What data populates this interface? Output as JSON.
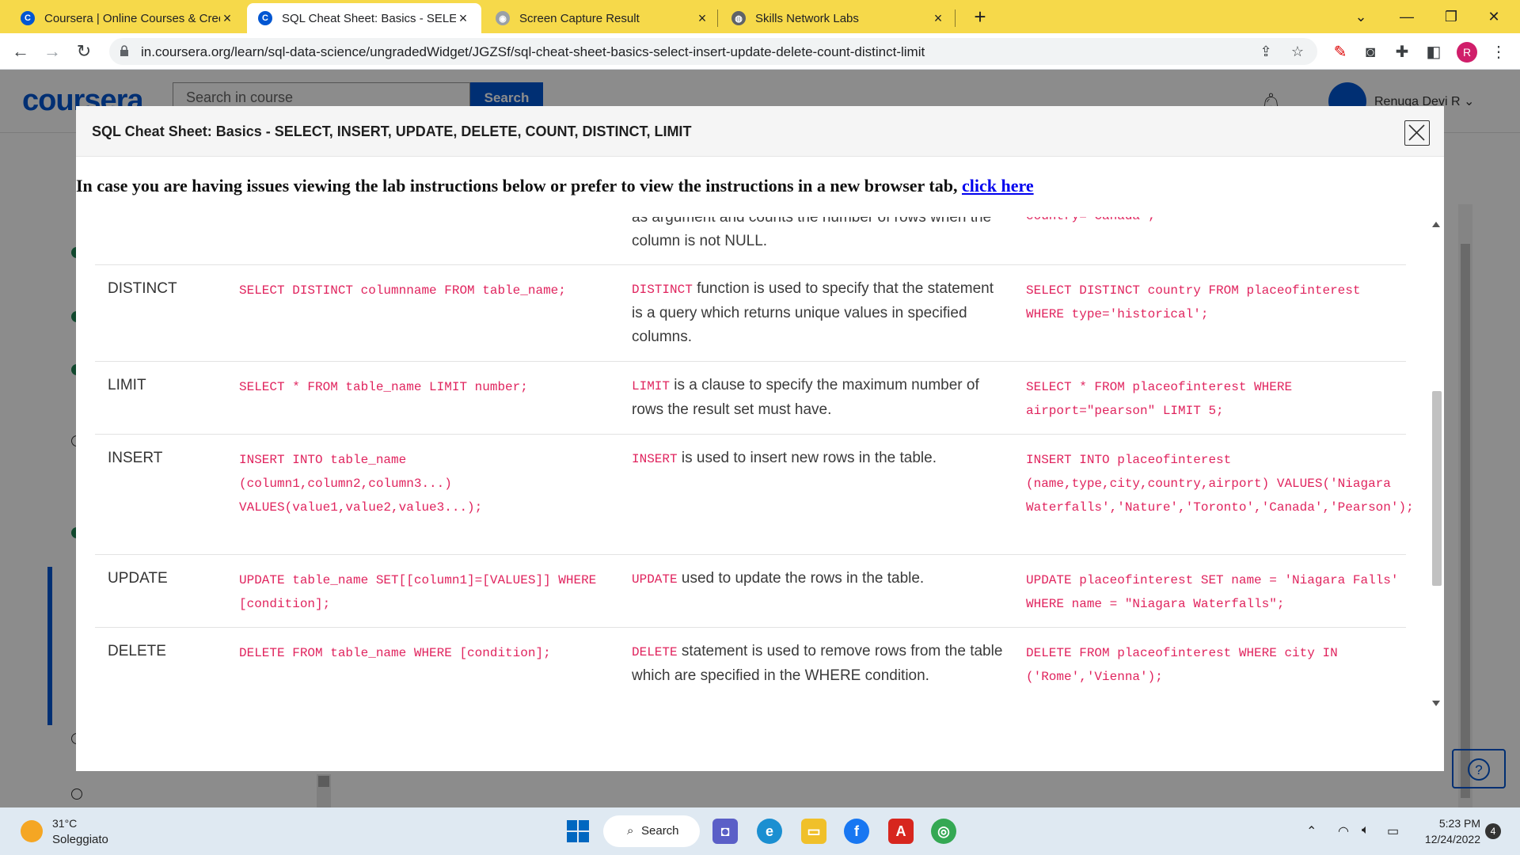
{
  "browser": {
    "tabs": [
      {
        "title": "Coursera | Online Courses & Cred",
        "icon": "coursera-icon",
        "active": false
      },
      {
        "title": "SQL Cheat Sheet: Basics - SELECT",
        "icon": "coursera-icon",
        "active": true
      },
      {
        "title": "Screen Capture Result",
        "icon": "camera-icon",
        "active": false
      },
      {
        "title": "Skills Network Labs",
        "icon": "globe-icon",
        "active": false
      }
    ],
    "url": "in.coursera.org/learn/sql-data-science/ungradedWidget/JGZSf/sql-cheat-sheet-basics-select-insert-update-delete-count-distinct-limit",
    "profile_initial": "R"
  },
  "page": {
    "logo": "coursera",
    "search_placeholder": "Search in course",
    "search_button": "Search",
    "user_name": "Renuga Devi R"
  },
  "modal": {
    "title": "SQL Cheat Sheet: Basics - SELECT, INSERT, UPDATE, DELETE, COUNT, DISTINCT, LIMIT",
    "notice_text": "In case you are having issues viewing the lab instructions below or prefer to view the instructions in a new browser tab, ",
    "notice_link": "click here",
    "partial_row": {
      "description": "as argument and counts the number of rows when the column is not NULL.",
      "example": "country='Canada';"
    },
    "rows": [
      {
        "command": "DISTINCT",
        "syntax": "SELECT DISTINCT columnname FROM table_name;",
        "desc_keyword": "DISTINCT",
        "description": " function is used to specify that the statement is a query which returns unique values in specified columns.",
        "example": "SELECT DISTINCT country FROM placeofinterest WHERE type='historical';"
      },
      {
        "command": "LIMIT",
        "syntax": "SELECT * FROM table_name LIMIT number;",
        "desc_keyword": "LIMIT",
        "description": " is a clause to specify the maximum number of rows the result set must have.",
        "example": "SELECT * FROM placeofinterest WHERE airport=\"pearson\" LIMIT 5;"
      },
      {
        "command": "INSERT",
        "syntax": "INSERT INTO table_name (column1,column2,column3...) VALUES(value1,value2,value3...);",
        "desc_keyword": "INSERT",
        "description": " is used to insert new rows in the table.",
        "example": "INSERT INTO placeofinterest (name,type,city,country,airport) VALUES('Niagara Waterfalls','Nature','Toronto','Canada','Pearson');"
      },
      {
        "command": "UPDATE",
        "syntax": "UPDATE table_name SET[[column1]=[VALUES]] WHERE [condition];",
        "desc_keyword": "UPDATE",
        "description": " used to update the rows in the table.",
        "example": "UPDATE placeofinterest SET name = 'Niagara Falls' WHERE name = \"Niagara Waterfalls\";"
      },
      {
        "command": "DELETE",
        "syntax": "DELETE FROM table_name WHERE [condition];",
        "desc_keyword": "DELETE",
        "description": " statement is used to remove rows from the table which are specified in the WHERE condition.",
        "example": "DELETE FROM placeofinterest WHERE city IN ('Rome','Vienna');"
      }
    ]
  },
  "taskbar": {
    "temperature": "31°C",
    "weather": "Soleggiato",
    "search_label": "Search",
    "time": "5:23 PM",
    "date": "12/24/2022",
    "notification_count": "4"
  },
  "colors": {
    "tabstrip": "#f6d94a",
    "accent": "#0056d2",
    "code": "#e0245e",
    "link": "#0000ee"
  }
}
